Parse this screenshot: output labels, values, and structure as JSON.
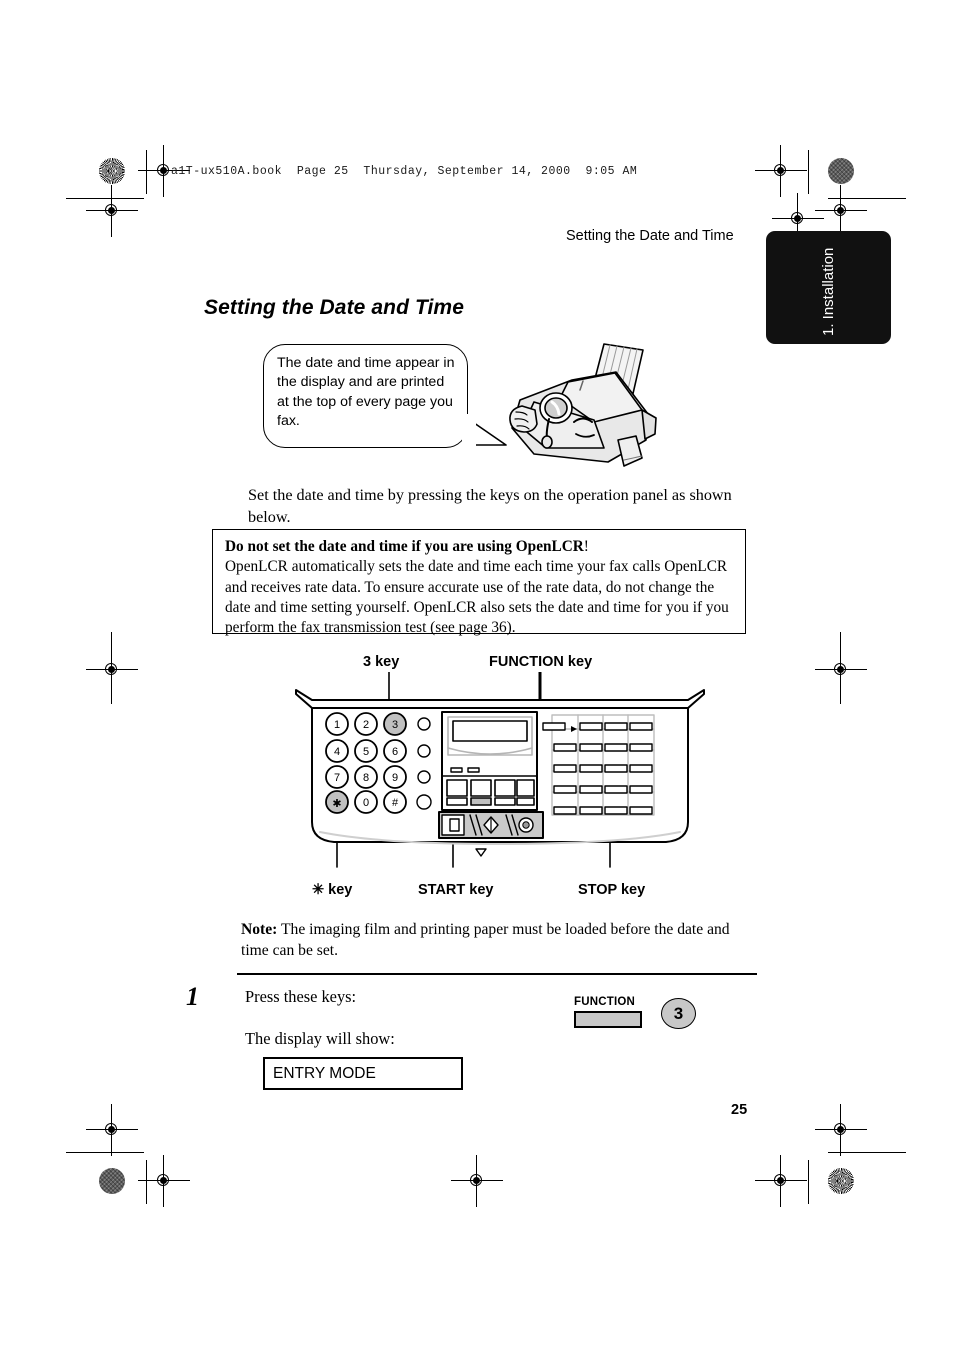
{
  "book_header": "a1T-ux510A.book  Page 25  Thursday, September 14, 2000  9:05 AM",
  "running_head": "Setting the Date and Time",
  "chapter_tab": {
    "label": "1. Installation"
  },
  "section_title": "Setting the Date and Time",
  "balloon": {
    "text": "The date and time appear in the display and are printed at the top of every page you fax."
  },
  "intro": "Set the date and time by pressing the keys on the operation panel as shown below.",
  "caution": {
    "title": "Do not set the date and time if you are using OpenLCR",
    "title_bang": "!",
    "body": "OpenLCR automatically sets the date and time each time your fax calls OpenLCR and receives rate data. To ensure accurate use of the rate data, do not change the date and time setting yourself. OpenLCR also sets the date and time for you if you perform the fax transmission test (see page 36)."
  },
  "figure": {
    "callouts": {
      "three_key": "3 key",
      "function_key": "FUNCTION key",
      "star_key": "✳ key",
      "start_key": "START key",
      "stop_key": "STOP key"
    },
    "keypad": [
      [
        "1",
        "2",
        "3"
      ],
      [
        "4",
        "5",
        "6"
      ],
      [
        "7",
        "8",
        "9"
      ],
      [
        "✳",
        "0",
        "#"
      ]
    ],
    "highlighted_keys": [
      "3",
      "✳"
    ]
  },
  "note": {
    "label": "Note:",
    "text": " The imaging film and printing paper must be loaded before the date and time can be set."
  },
  "step": {
    "number": "1",
    "line1": "Press these keys:",
    "line2": "The display will show:",
    "function_key_label": "FUNCTION",
    "number_key_label": "3"
  },
  "display_result": "ENTRY MODE",
  "page_number": "25",
  "colors": {
    "tab_background": "#111111",
    "key_gray": "#c8c8c8",
    "panel_gray": "#d7d7d7",
    "ink": "#000000"
  }
}
